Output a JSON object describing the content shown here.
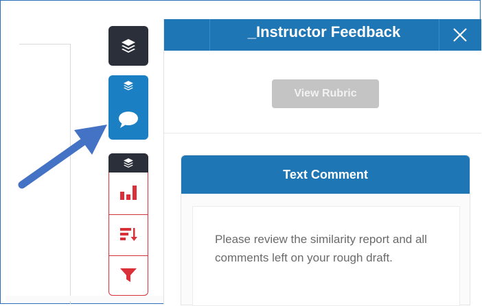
{
  "panel": {
    "title": "_Instructor Feedback",
    "close_icon": "close-icon",
    "view_rubric_label": "View Rubric"
  },
  "comment": {
    "header": "Text Comment",
    "text": "Please review the similarity report and all comments left on your rough draft."
  },
  "toolbar": {
    "icons": [
      "layers-icon",
      "layers-icon",
      "comment-icon",
      "layers-icon",
      "bar-chart-icon",
      "sort-icon",
      "filter-icon"
    ]
  },
  "colors": {
    "header_blue": "#1e76b5",
    "dark": "#2b2f3a",
    "active_blue": "#1b7fc3",
    "red": "#d9303a",
    "button_disabled": "#c4c4c4",
    "annotation_arrow": "#4472c4"
  }
}
